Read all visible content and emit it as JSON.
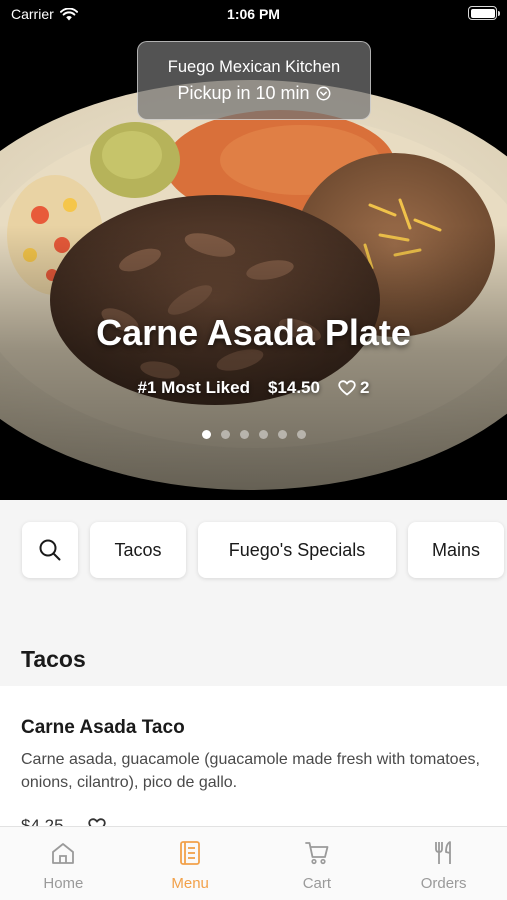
{
  "status_bar": {
    "carrier": "Carrier",
    "time": "1:06 PM"
  },
  "header": {
    "restaurant_name": "Fuego Mexican Kitchen",
    "pickup_text": "Pickup in 10 min"
  },
  "hero": {
    "title": "Carne Asada Plate",
    "badge": "#1 Most Liked",
    "price": "$14.50",
    "likes": "2",
    "slides_total": 6,
    "active_slide": 1
  },
  "categories": [
    "Tacos",
    "Fuego's Specials",
    "Mains"
  ],
  "section": {
    "title": "Tacos"
  },
  "items": [
    {
      "name": "Carne Asada Taco",
      "description": "Carne asada, guacamole (guacamole made fresh with tomatoes, onions, cilantro), pico de gallo.",
      "price": "$4.25"
    }
  ],
  "tabs": [
    {
      "label": "Home",
      "icon": "home-icon",
      "active": false
    },
    {
      "label": "Menu",
      "icon": "menu-book-icon",
      "active": true
    },
    {
      "label": "Cart",
      "icon": "cart-icon",
      "active": false
    },
    {
      "label": "Orders",
      "icon": "utensils-icon",
      "active": false
    }
  ],
  "colors": {
    "accent": "#f2a14a",
    "inactive_tab": "#9a9a9a"
  }
}
